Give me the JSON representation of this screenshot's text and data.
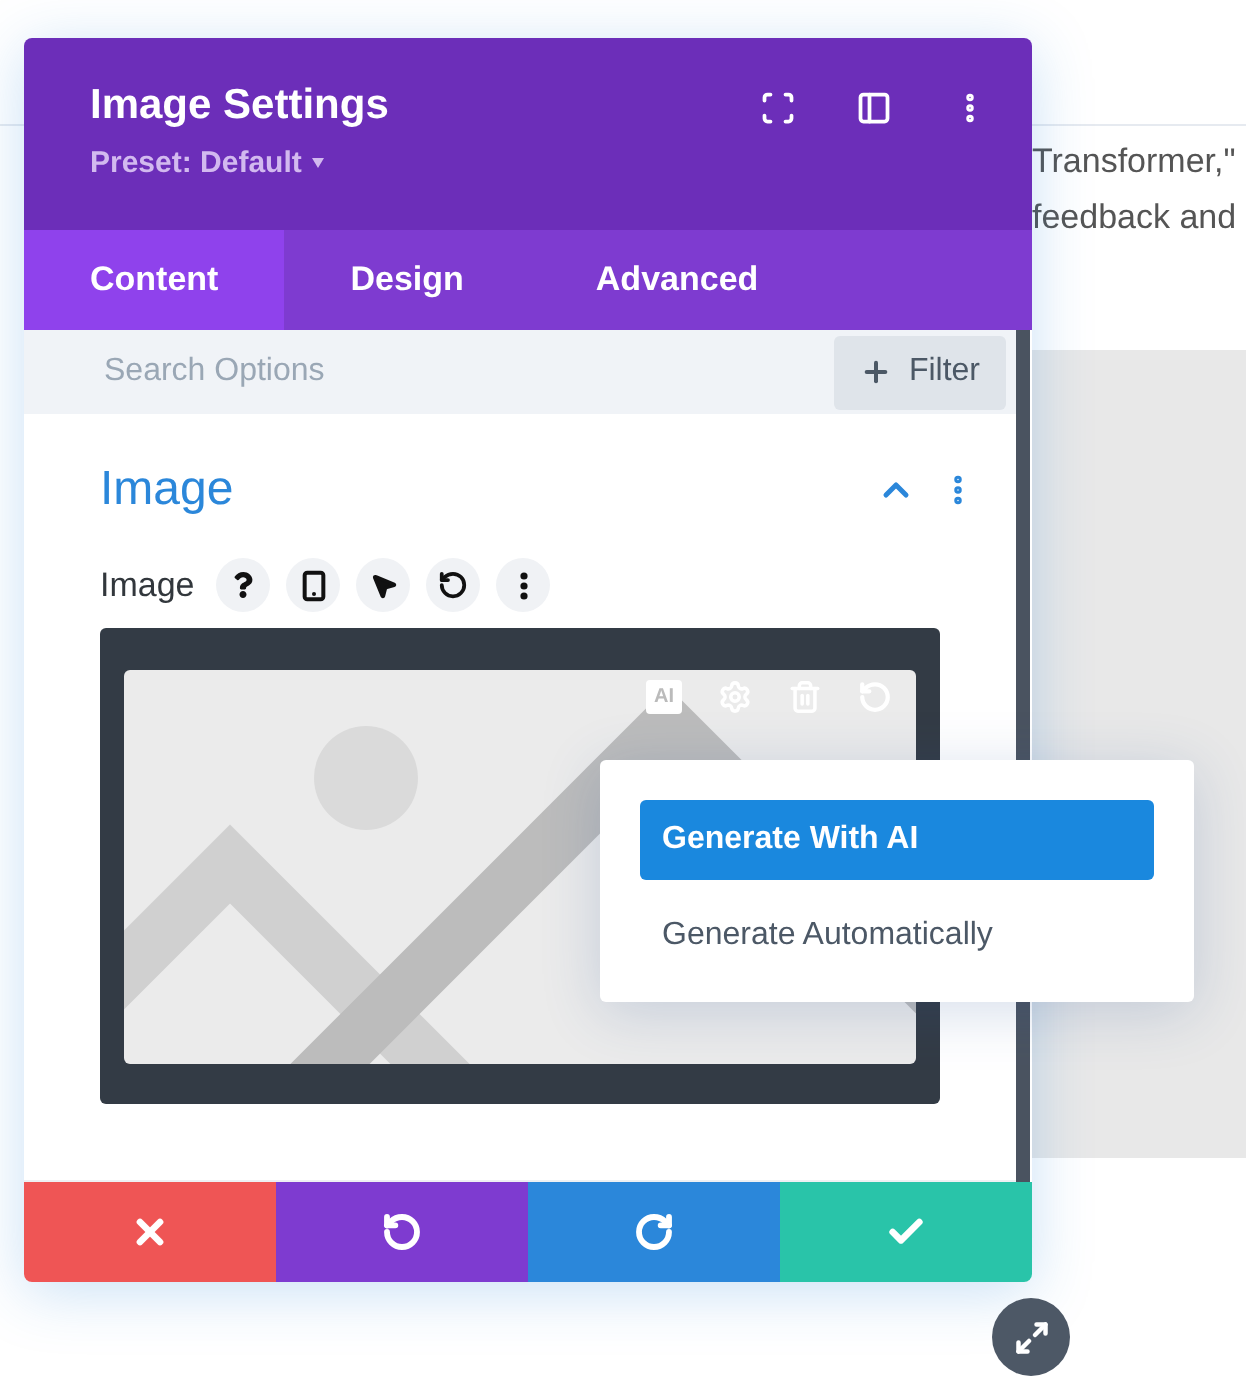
{
  "background_text": [
    "Transformer,\"",
    "feedback and"
  ],
  "panel": {
    "title": "Image Settings",
    "preset": "Preset: Default"
  },
  "tabs": [
    {
      "label": "Content",
      "selected": true
    },
    {
      "label": "Design",
      "selected": false
    },
    {
      "label": "Advanced",
      "selected": false
    }
  ],
  "search": {
    "placeholder": "Search Options"
  },
  "filter_button": "Filter",
  "section": {
    "title": "Image",
    "expanded": true
  },
  "field": {
    "label": "Image"
  },
  "image_toolbar": {
    "ai_badge": "AI"
  },
  "menu": {
    "items": [
      {
        "label": "Generate With AI",
        "selected": true
      },
      {
        "label": "Generate Automatically",
        "selected": false
      }
    ]
  }
}
